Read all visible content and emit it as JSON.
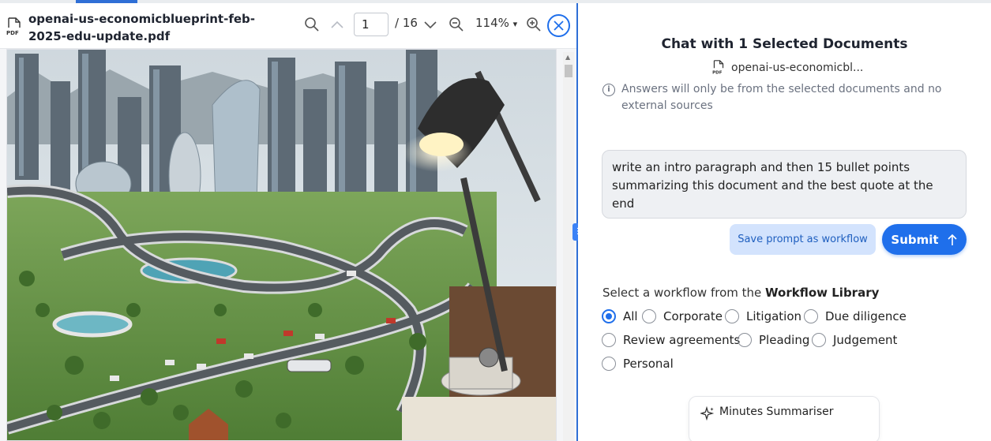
{
  "viewer": {
    "filename": "openai-us-economicblueprint-feb-2025-edu-update.pdf",
    "file_type_badge": "PDF",
    "current_page": "1",
    "page_total": "/ 16",
    "zoom": "114%",
    "zoom_caret": "▾"
  },
  "chat": {
    "title": "Chat with 1 Selected Documents",
    "selected_doc": "openai-us-economicbl...",
    "info": "Answers will only be from the selected documents and no external sources",
    "prompt": "write an intro paragraph and then 15 bullet points summarizing this document and the best quote at the end",
    "save_prompt_label": "Save prompt as workflow",
    "submit_label": "Submit",
    "workflow_label_prefix": "Select a workflow from the",
    "workflow_label_bold": "Workflow Library",
    "workflow_options": [
      "All",
      "Corporate",
      "Litigation",
      "Due diligence",
      "Review agreements",
      "Pleading",
      "Judgement",
      "Personal"
    ],
    "selected_workflow": "All",
    "workflow_card": "Minutes Summariser"
  },
  "colors": {
    "accent": "#1f6feb",
    "save_button_bg": "#d3e3fd"
  }
}
